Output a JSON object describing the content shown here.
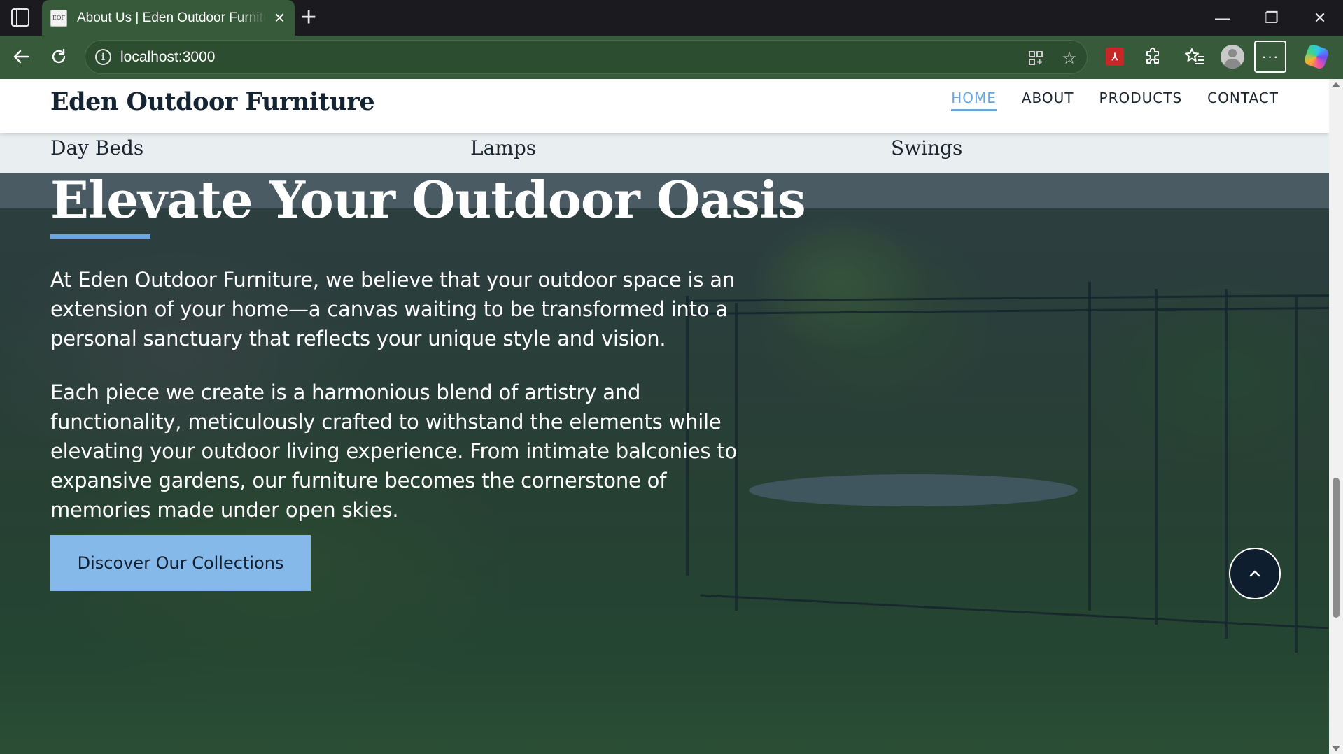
{
  "browser": {
    "tab_title": "About Us | Eden Outdoor Furniture",
    "favicon_text": "EOF",
    "url": "localhost:3000",
    "icons": {
      "sidebar": "sidebar-toggle-icon",
      "close_tab": "close-icon",
      "new_tab": "plus-icon",
      "back": "back-arrow-icon",
      "reload": "reload-icon",
      "info": "info-icon",
      "app_install": "apps-icon",
      "favorite": "star-icon",
      "pdf": "pdf-icon",
      "extensions": "puzzle-icon",
      "favorites_list": "favorites-icon",
      "profile": "avatar-icon",
      "more": "more-icon",
      "copilot": "copilot-icon"
    },
    "window_controls": {
      "minimize": "—",
      "restore": "❐",
      "close": "✕"
    }
  },
  "site": {
    "brand": "Eden Outdoor Furniture",
    "nav": [
      {
        "label": "HOME",
        "active": true
      },
      {
        "label": "ABOUT",
        "active": false
      },
      {
        "label": "PRODUCTS",
        "active": false
      },
      {
        "label": "CONTACT",
        "active": false
      }
    ],
    "categories": [
      "Day Beds",
      "Lamps",
      "Swings"
    ],
    "hero": {
      "title": "Elevate Your Outdoor Oasis",
      "paragraph1": "At Eden Outdoor Furniture, we believe that your outdoor space is an extension of your home—a canvas waiting to be transformed into a personal sanctuary that reflects your unique style and vision.",
      "paragraph2": "Each piece we create is a harmonious blend of artistry and functionality, meticulously crafted to withstand the elements while elevating your outdoor living experience. From intimate balconies to expansive gardens, our furniture becomes the cornerstone of memories made under open skies.",
      "cta": "Discover Our Collections"
    },
    "back_to_top_icon": "chevron-up-icon"
  },
  "colors": {
    "accent": "#6aa7dc",
    "cta_bg": "#85b9ea",
    "brand_text": "#152433",
    "browser_green": "#375a3a"
  }
}
